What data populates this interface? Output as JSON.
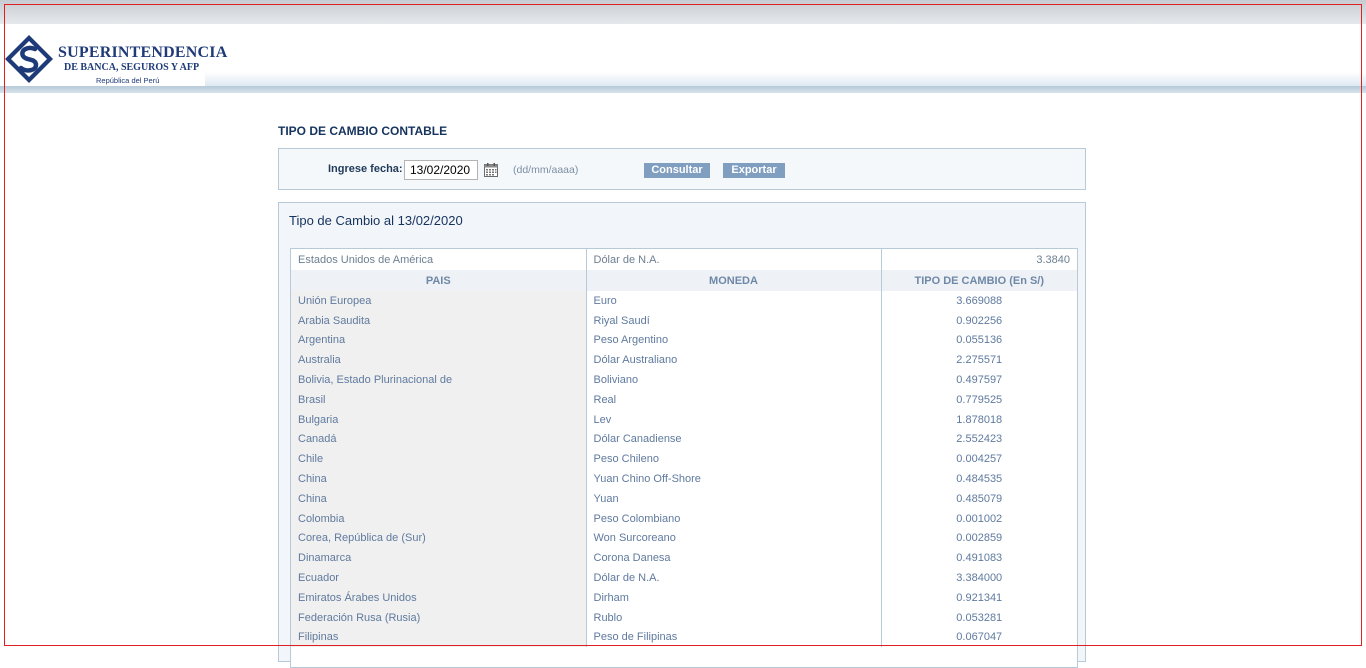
{
  "brand": {
    "title": "SUPERINTENDENCIA",
    "subtitle": "DE BANCA, SEGUROS Y AFP",
    "country": "República del Perú",
    "colors": {
      "primary": "#1f3a78",
      "accent": "#7f9ec0"
    }
  },
  "page_title": "TIPO DE CAMBIO CONTABLE",
  "search": {
    "label": "Ingrese fecha:",
    "date_value": "13/02/2020",
    "date_format_hint": "(dd/mm/aaaa)",
    "consult_button": "Consultar",
    "export_button": "Exportar",
    "calendar_icon": "calendar-icon"
  },
  "results": {
    "title": "Tipo de Cambio al 13/02/2020",
    "top_row": {
      "pais": "Estados Unidos de América",
      "moneda": "Dólar de N.A.",
      "tc": "3.3840"
    },
    "headers": {
      "pais": "PAIS",
      "moneda": "MONEDA",
      "tc": "TIPO DE CAMBIO (En S/)"
    },
    "rows": [
      {
        "pais": "Unión Europea",
        "moneda": "Euro",
        "tc": "3.669088"
      },
      {
        "pais": "Arabia Saudita",
        "moneda": "Riyal Saudí",
        "tc": "0.902256"
      },
      {
        "pais": "Argentina",
        "moneda": "Peso Argentino",
        "tc": "0.055136"
      },
      {
        "pais": "Australia",
        "moneda": "Dólar Australiano",
        "tc": "2.275571"
      },
      {
        "pais": "Bolivia, Estado Plurinacional de",
        "moneda": "Boliviano",
        "tc": "0.497597"
      },
      {
        "pais": "Brasil",
        "moneda": "Real",
        "tc": "0.779525"
      },
      {
        "pais": "Bulgaria",
        "moneda": "Lev",
        "tc": "1.878018"
      },
      {
        "pais": "Canadá",
        "moneda": "Dólar Canadiense",
        "tc": "2.552423"
      },
      {
        "pais": "Chile",
        "moneda": "Peso Chileno",
        "tc": "0.004257"
      },
      {
        "pais": "China",
        "moneda": "Yuan Chino Off-Shore",
        "tc": "0.484535"
      },
      {
        "pais": "China",
        "moneda": "Yuan",
        "tc": "0.485079"
      },
      {
        "pais": "Colombia",
        "moneda": "Peso Colombiano",
        "tc": "0.001002"
      },
      {
        "pais": "Corea, República de (Sur)",
        "moneda": "Won Surcoreano",
        "tc": "0.002859"
      },
      {
        "pais": "Dinamarca",
        "moneda": "Corona Danesa",
        "tc": "0.491083"
      },
      {
        "pais": "Ecuador",
        "moneda": "Dólar de N.A.",
        "tc": "3.384000"
      },
      {
        "pais": "Emiratos Árabes Unidos",
        "moneda": "Dirham",
        "tc": "0.921341"
      },
      {
        "pais": "Federación Rusa (Rusia)",
        "moneda": "Rublo",
        "tc": "0.053281"
      },
      {
        "pais": "Filipinas",
        "moneda": "Peso de Filipinas",
        "tc": "0.067047"
      }
    ]
  }
}
